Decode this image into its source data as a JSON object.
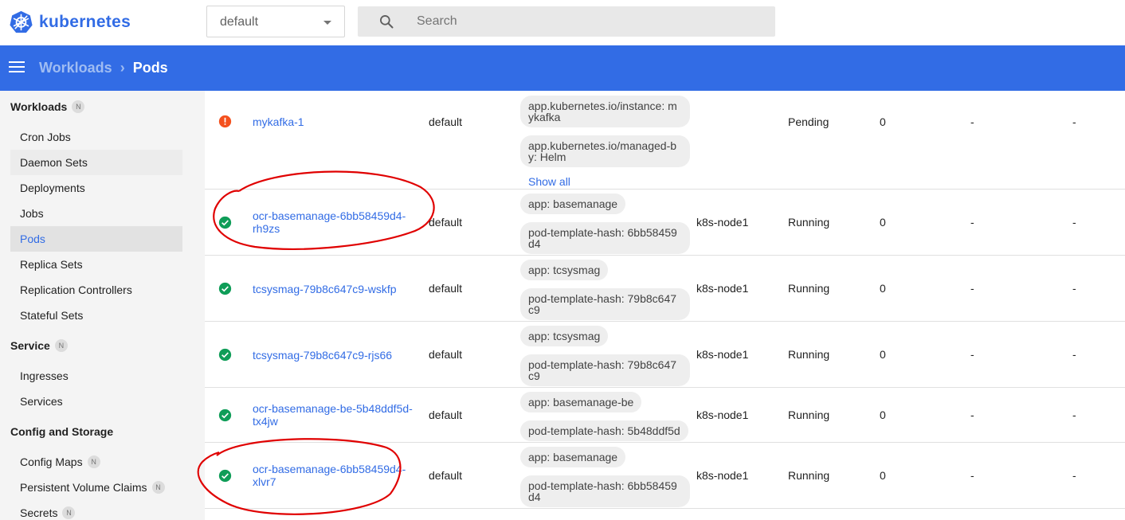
{
  "app": {
    "name": "kubernetes",
    "brand_color": "#326ce5"
  },
  "namespace": {
    "selected": "default"
  },
  "search": {
    "placeholder": "Search"
  },
  "breadcrumb": {
    "parent": "Workloads",
    "current": "Pods"
  },
  "sidebar": {
    "sections": [
      {
        "label": "Workloads",
        "badge": "N"
      },
      {
        "label": "Service",
        "badge": "N"
      },
      {
        "label": "Config and Storage"
      }
    ],
    "items": [
      {
        "label": "Cron Jobs"
      },
      {
        "label": "Daemon Sets"
      },
      {
        "label": "Deployments"
      },
      {
        "label": "Jobs"
      },
      {
        "label": "Pods",
        "active": true
      },
      {
        "label": "Replica Sets"
      },
      {
        "label": "Replication Controllers"
      },
      {
        "label": "Stateful Sets"
      },
      {
        "label": "Ingresses"
      },
      {
        "label": "Services"
      },
      {
        "label": "Config Maps",
        "badge": "N"
      },
      {
        "label": "Persistent Volume Claims",
        "badge": "N"
      },
      {
        "label": "Secrets",
        "badge": "N"
      }
    ]
  },
  "pods": [
    {
      "status_icon": "error-icon",
      "name": "mykafka-1",
      "namespace": "default",
      "labels": [
        "app.kubernetes.io/instance: mykafka",
        "app.kubernetes.io/managed-by: Helm"
      ],
      "show_all": "Show all",
      "node": "",
      "status": "Pending",
      "restarts": "0",
      "cpu": "-",
      "memory": "-"
    },
    {
      "status_icon": "check-circle-icon",
      "name": "ocr-basemanage-6bb58459d4-rh9zs",
      "namespace": "default",
      "labels": [
        "app: basemanage",
        "pod-template-hash: 6bb58459d4"
      ],
      "node": "k8s-node1",
      "status": "Running",
      "restarts": "0",
      "cpu": "-",
      "memory": "-"
    },
    {
      "status_icon": "check-circle-icon",
      "name": "tcsysmag-79b8c647c9-wskfp",
      "namespace": "default",
      "labels": [
        "app: tcsysmag",
        "pod-template-hash: 79b8c647c9"
      ],
      "node": "k8s-node1",
      "status": "Running",
      "restarts": "0",
      "cpu": "-",
      "memory": "-"
    },
    {
      "status_icon": "check-circle-icon",
      "name": "tcsysmag-79b8c647c9-rjs66",
      "namespace": "default",
      "labels": [
        "app: tcsysmag",
        "pod-template-hash: 79b8c647c9"
      ],
      "node": "k8s-node1",
      "status": "Running",
      "restarts": "0",
      "cpu": "-",
      "memory": "-"
    },
    {
      "status_icon": "check-circle-icon",
      "name": "ocr-basemanage-be-5b48ddf5d-tx4jw",
      "namespace": "default",
      "labels": [
        "app: basemanage-be",
        "pod-template-hash: 5b48ddf5d"
      ],
      "node": "k8s-node1",
      "status": "Running",
      "restarts": "0",
      "cpu": "-",
      "memory": "-"
    },
    {
      "status_icon": "check-circle-icon",
      "name": "ocr-basemanage-6bb58459d4-xlvr7",
      "namespace": "default",
      "labels": [
        "app: basemanage",
        "pod-template-hash: 6bb58459d4"
      ],
      "node": "k8s-node1",
      "status": "Running",
      "restarts": "0",
      "cpu": "-",
      "memory": "-"
    }
  ],
  "colors": {
    "ok": "#0f9d58",
    "error": "#f4511e",
    "annotation": "#e00000"
  }
}
